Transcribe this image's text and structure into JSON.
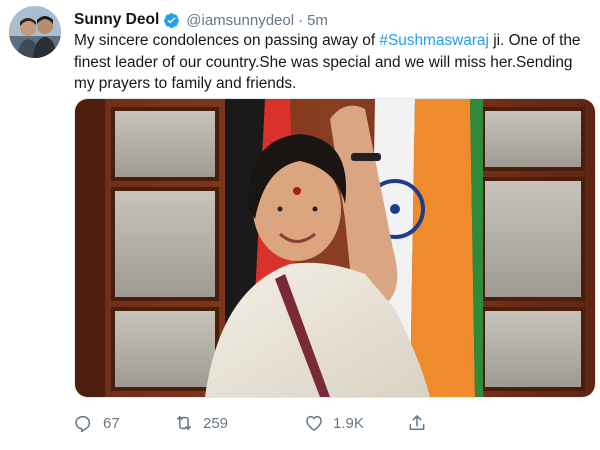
{
  "tweet": {
    "author": {
      "display_name": "Sunny Deol",
      "handle": "@iamsunnydeol",
      "verified": true,
      "avatar_icon": "profile-photo"
    },
    "separator": "·",
    "timestamp": "5m",
    "text": {
      "part1": "My sincere condolences on passing away of ",
      "hashtag": "#Sushmaswaraj",
      "part2": " ji. One of the finest leader of our country.She was special and we will miss her.Sending my prayers to family and friends."
    },
    "media": {
      "icon": "photo"
    },
    "actions": {
      "reply": {
        "icon": "reply-icon",
        "count": "67"
      },
      "retweet": {
        "icon": "retweet-icon",
        "count": "259"
      },
      "like": {
        "icon": "heart-icon",
        "count": "1.9K"
      },
      "share": {
        "icon": "share-icon"
      }
    },
    "colors": {
      "link": "#1da1f2",
      "secondary_text": "#657786",
      "primary_text": "#14171a"
    }
  }
}
